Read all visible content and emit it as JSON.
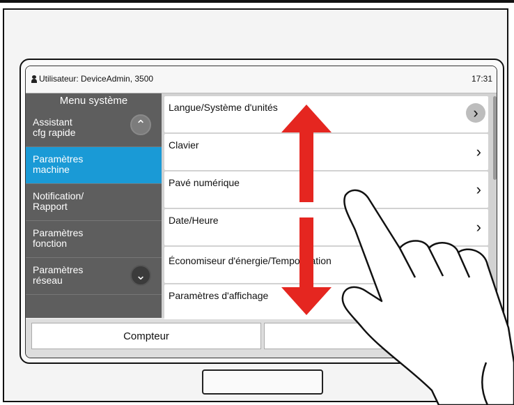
{
  "status": {
    "user": "Utilisateur: DeviceAdmin, 3500",
    "clock": "17:31"
  },
  "sidebar": {
    "title": "Menu système",
    "items": [
      {
        "label": "Assistant\ncfg rapide"
      },
      {
        "label": "Paramètres\nmachine",
        "selected": true
      },
      {
        "label": "Notification/\nRapport"
      },
      {
        "label": "Paramètres\nfonction"
      },
      {
        "label": "Paramètres\nréseau"
      }
    ],
    "scroll_up_icon": "chevron-up-icon",
    "scroll_down_icon": "chevron-down-icon"
  },
  "list": {
    "items": [
      {
        "label": "Langue/Système d'unités"
      },
      {
        "label": "Clavier"
      },
      {
        "label": "Pavé numérique"
      },
      {
        "label": "Date/Heure"
      },
      {
        "label": "Économiseur d'énergie/Temporisation"
      },
      {
        "label": "Paramètres d'affichage"
      }
    ],
    "chevron_icon": "chevron-right-icon"
  },
  "bottom": {
    "counter_label": "Compteur",
    "up_icon": "double-chevron-up-icon"
  },
  "colors": {
    "selected": "#1a9ad6",
    "sidebar": "#5e5e5e",
    "arrow": "#e52620"
  },
  "overlay": {
    "gesture": "vertical-swipe-arrows",
    "hand": "pointing-hand"
  }
}
